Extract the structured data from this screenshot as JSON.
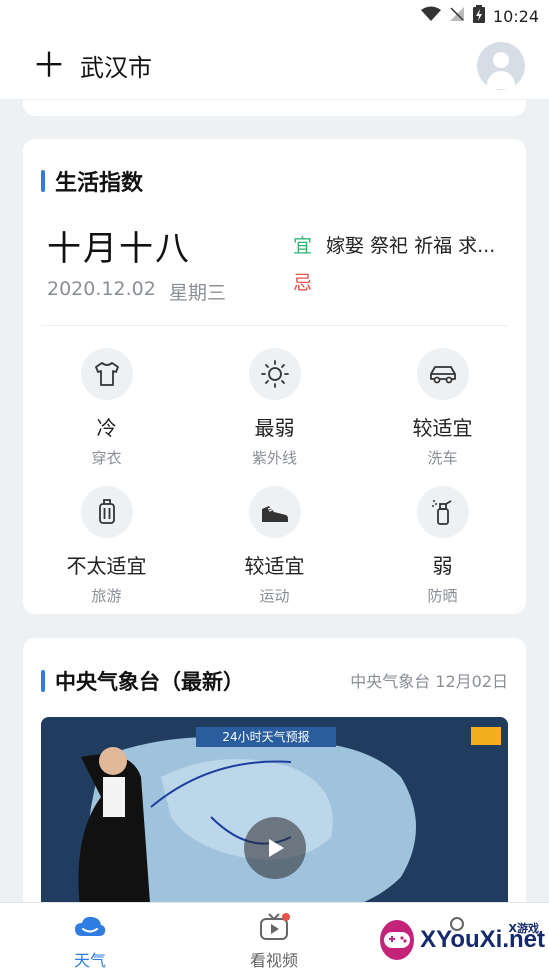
{
  "status_bar": {
    "time": "10:24"
  },
  "header": {
    "city": "武汉市",
    "add_icon": "plus-icon",
    "avatar_icon": "user-avatar-icon"
  },
  "life_index": {
    "title": "生活指数",
    "lunar_date": "十月十八",
    "solar_date": "2020.12.02",
    "weekday": "星期三",
    "yi_label": "宜",
    "yi_text": "嫁娶 祭祀 祈福 求...",
    "ji_label": "忌",
    "items": [
      {
        "value": "冷",
        "name": "穿衣",
        "icon": "tshirt-icon"
      },
      {
        "value": "最弱",
        "name": "紫外线",
        "icon": "sun-icon"
      },
      {
        "value": "较适宜",
        "name": "洗车",
        "icon": "car-icon"
      },
      {
        "value": "不太适宜",
        "name": "旅游",
        "icon": "luggage-icon"
      },
      {
        "value": "较适宜",
        "name": "运动",
        "icon": "sneaker-icon"
      },
      {
        "value": "弱",
        "name": "防晒",
        "icon": "sunscreen-icon"
      }
    ]
  },
  "cma": {
    "title": "中央气象台（最新）",
    "source": "中央气象台 12月02日",
    "video_banner": "24小时天气预报"
  },
  "tabbar": {
    "weather": "天气",
    "video": "看视频"
  },
  "watermark": {
    "brand": "XYouXi.net",
    "small": "X游戏"
  },
  "colors": {
    "accent": "#2f7de1",
    "yi": "#2bb673",
    "ji": "#e9534d",
    "background": "#eef1f4"
  }
}
